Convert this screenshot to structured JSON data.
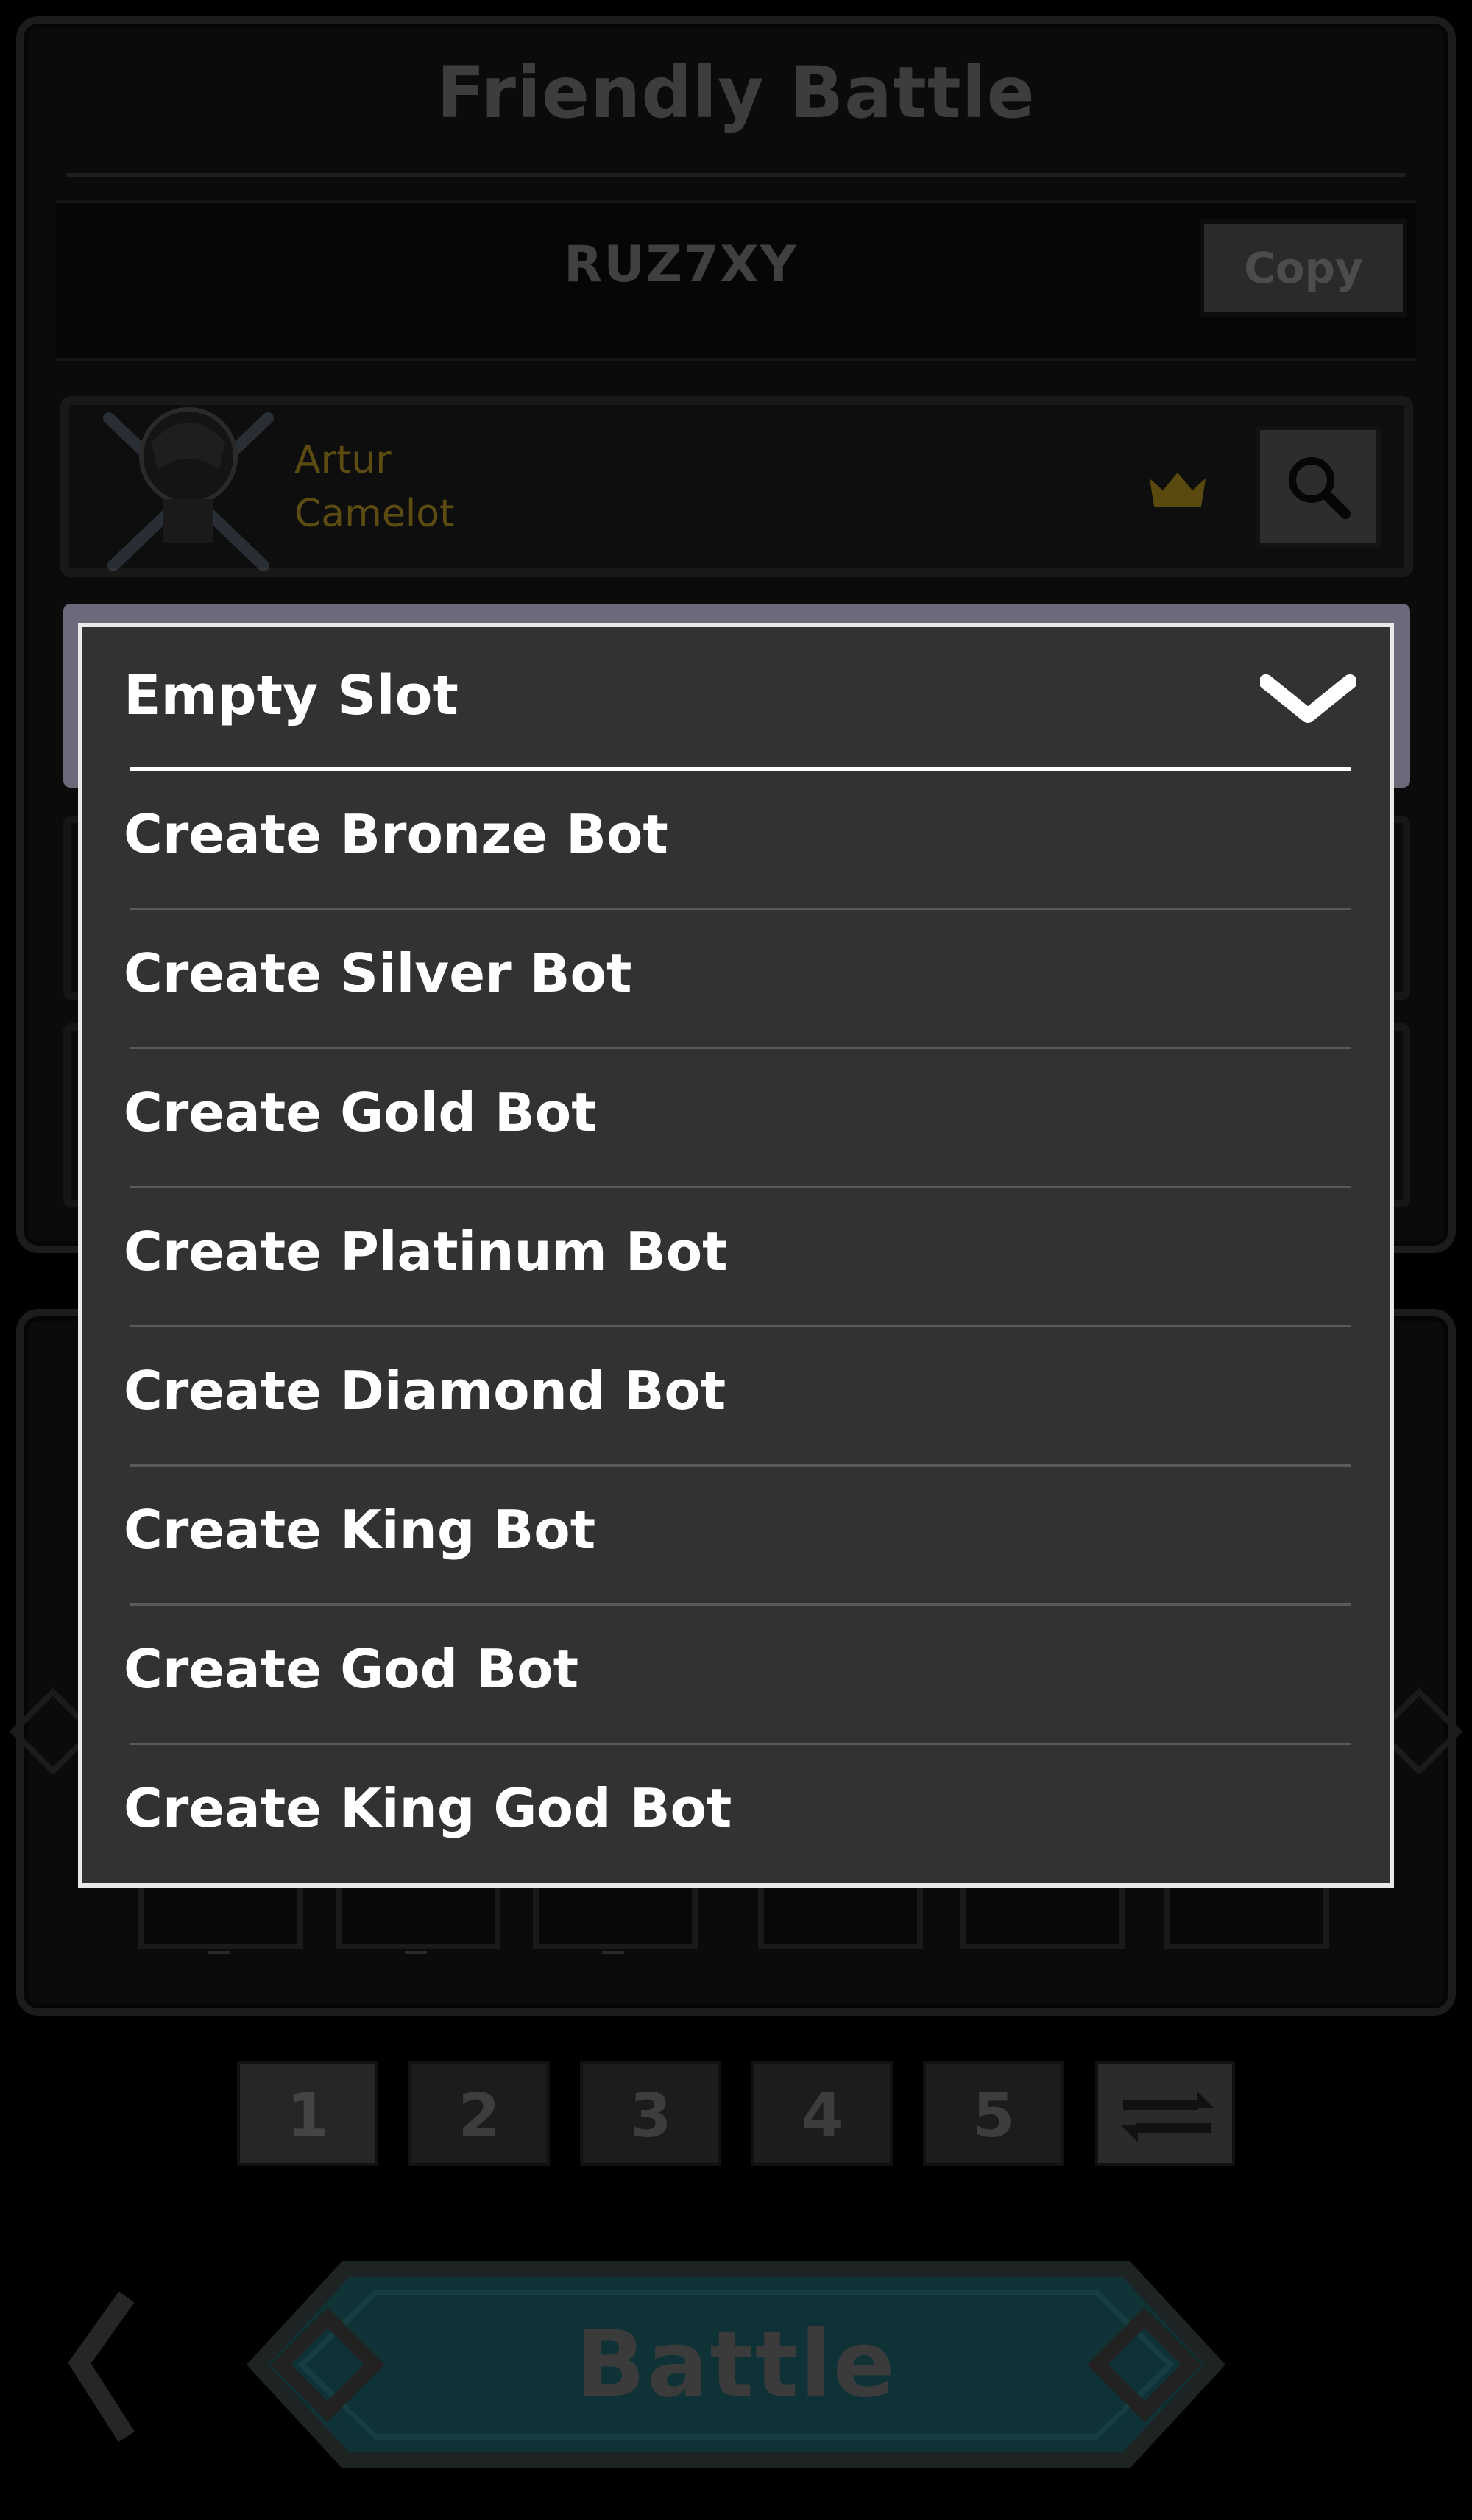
{
  "header": {
    "title": "Friendly Battle"
  },
  "room": {
    "code": "RUZ7XY",
    "copy_label": "Copy"
  },
  "player": {
    "name": "Artur",
    "guild": "Camelot"
  },
  "dropdown": {
    "selected": "Empty Slot",
    "options": [
      "Create Bronze Bot",
      "Create Silver Bot",
      "Create Gold Bot",
      "Create Platinum Bot",
      "Create Diamond Bot",
      "Create King Bot",
      "Create God Bot",
      "Create King God Bot"
    ]
  },
  "team": {
    "empty_marker": "-"
  },
  "deck_tabs": [
    "1",
    "2",
    "3",
    "4",
    "5"
  ],
  "battle": {
    "label": "Battle"
  },
  "colors": {
    "dropdown_bg": "#323232",
    "dropdown_border": "#e9e9e9",
    "guild_text": "#5c4c12",
    "battle_teal": "#0f3236"
  }
}
